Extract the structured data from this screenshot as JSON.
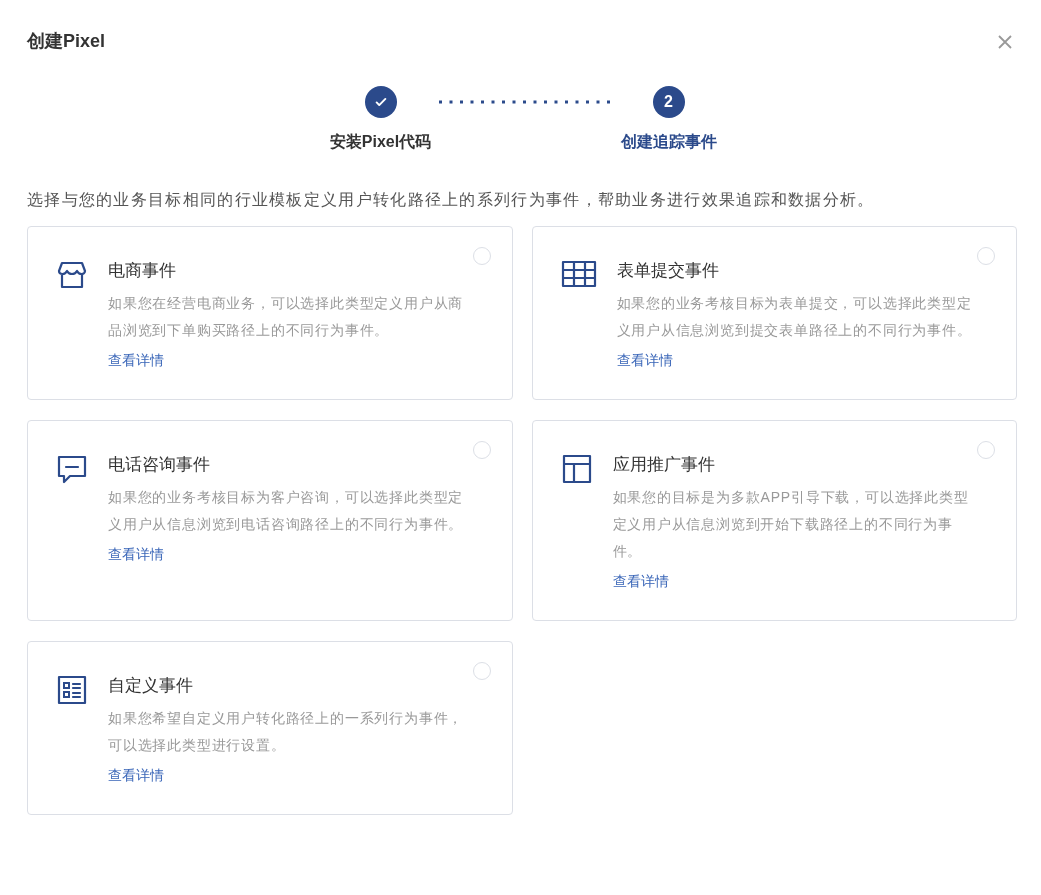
{
  "dialog": {
    "title": "创建Pixel"
  },
  "steps": [
    {
      "label": "安装Pixel代码",
      "done": true,
      "selected": false
    },
    {
      "number": "2",
      "label": "创建追踪事件",
      "done": false,
      "selected": true
    }
  ],
  "intro": "选择与您的业务目标相同的行业模板定义用户转化路径上的系列行为事件，帮助业务进行效果追踪和数据分析。",
  "cards": [
    {
      "title": "电商事件",
      "description": "如果您在经营电商业务，可以选择此类型定义用户从商品浏览到下单购买路径上的不同行为事件。",
      "link": "查看详情",
      "selected": false
    },
    {
      "title": "表单提交事件",
      "description": "如果您的业务考核目标为表单提交，可以选择此类型定义用户从信息浏览到提交表单路径上的不同行为事件。",
      "link": "查看详情",
      "selected": false
    },
    {
      "title": "电话咨询事件",
      "description": "如果您的业务考核目标为客户咨询，可以选择此类型定义用户从信息浏览到电话咨询路径上的不同行为事件。",
      "link": "查看详情",
      "selected": false
    },
    {
      "title": "应用推广事件",
      "description": "如果您的目标是为多款APP引导下载，可以选择此类型定义用户从信息浏览到开始下载路径上的不同行为事件。",
      "link": "查看详情",
      "selected": false
    },
    {
      "title": "自定义事件",
      "description": "如果您希望自定义用户转化路径上的一系列行为事件，可以选择此类型进行设置。",
      "link": "查看详情",
      "selected": false
    }
  ]
}
